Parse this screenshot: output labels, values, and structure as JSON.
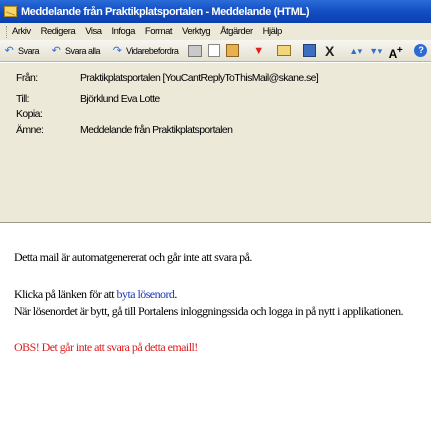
{
  "window": {
    "title": "Meddelande från Praktikplatsportalen - Meddelande (HTML)",
    "icon": "envelope-icon"
  },
  "menu": {
    "items": [
      "Arkiv",
      "Redigera",
      "Visa",
      "Infoga",
      "Format",
      "Verktyg",
      "Åtgärder",
      "Hjälp"
    ]
  },
  "toolbar": {
    "reply_label": "Svara",
    "reply_all_label": "Svara alla",
    "forward_label": "Vidarebefordra"
  },
  "header": {
    "from_label": "Från:",
    "from_value": "Praktikplatsportalen [YouCantReplyToThisMail@skane.se]",
    "to_label": "Till:",
    "to_value": "Björklund Eva Lotte",
    "cc_label": "Kopia:",
    "cc_value": "",
    "subject_label": "Ämne:",
    "subject_value": "Meddelande från Praktikplatsportalen"
  },
  "message": {
    "line1": "Detta mail är automatgenererat och går inte att svara på.",
    "line2_prefix": "Klicka på länken för att",
    "line2_link": "byta lösenord",
    "line2_suffix": ".",
    "line3": "När lösenordet är bytt, gå till Portalens inloggningssida och logga in på nytt i applikationen.",
    "warning": "OBS! Det går inte att svara på detta emaill!"
  },
  "colors": {
    "titlebar": "#1550c4",
    "chrome": "#ece9d8",
    "link": "#1a35b8",
    "warning": "#e01a1a"
  }
}
